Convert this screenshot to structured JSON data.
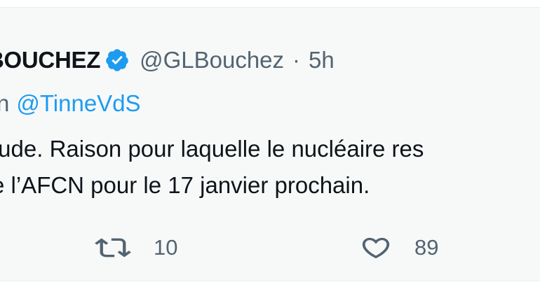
{
  "tweet": {
    "display_name": "BOUCHEZ",
    "verified": true,
    "handle": "@GLBouchez",
    "separator": "·",
    "time": "5h",
    "reply_prefix": "n",
    "reply_to": "@TinneVdS",
    "body_lines": [
      "tude. Raison pour laquelle le nucléaire res",
      "e l’AFCN pour le 17 janvier prochain."
    ],
    "retweet_count": "10",
    "like_count": "89"
  },
  "colors": {
    "background": "#f7f9f9",
    "text": "#0f1419",
    "secondary_text": "#536471",
    "link": "#1d9bf0",
    "verified_badge": "#1d9bf0"
  },
  "icons": {
    "verified": "verified-badge-icon",
    "retweet": "retweet-icon",
    "like": "heart-icon"
  }
}
